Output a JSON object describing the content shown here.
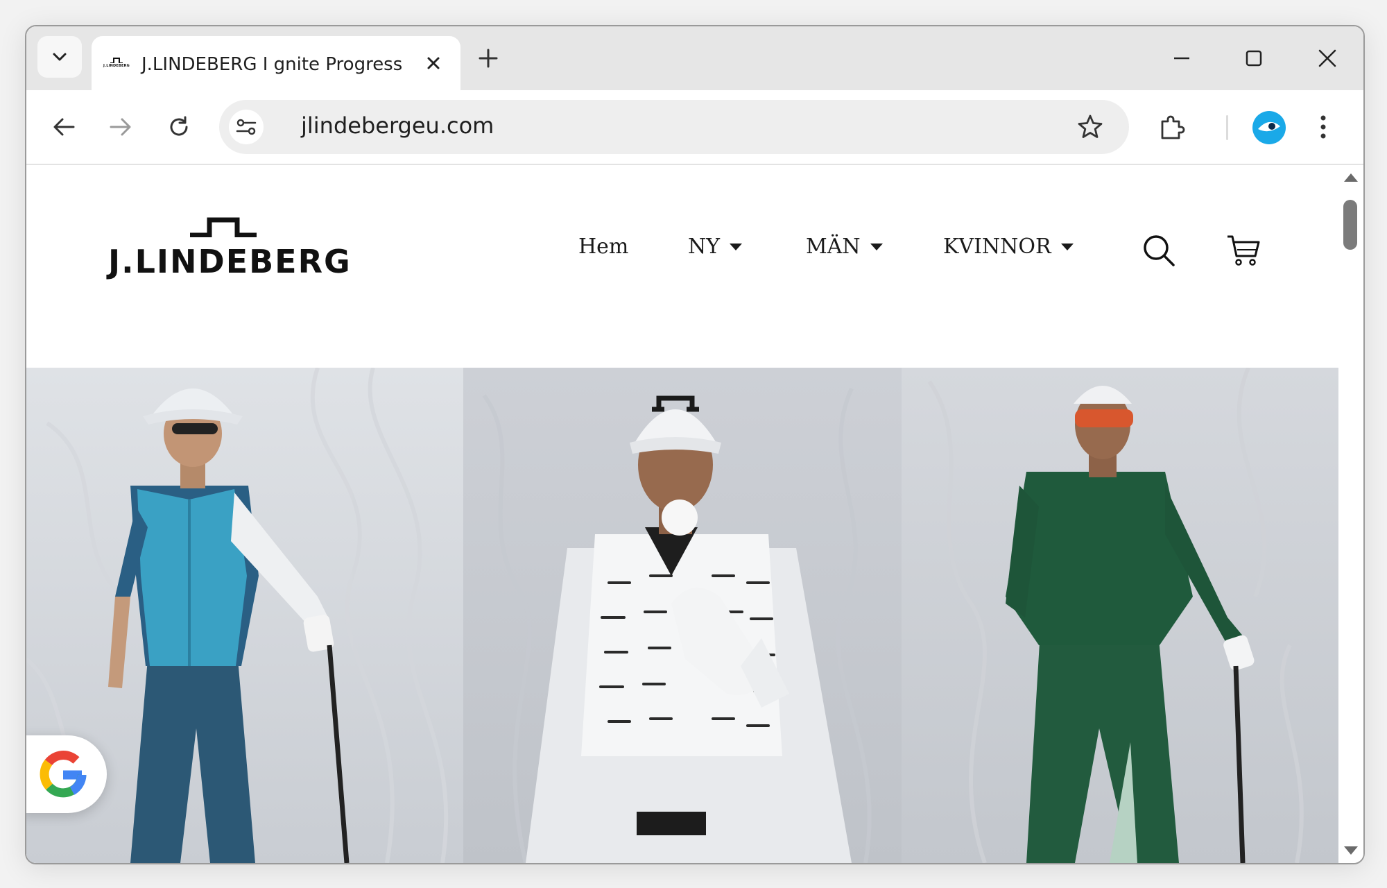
{
  "browser": {
    "tab": {
      "title": "J.LINDEBERG I gnite Progress",
      "favicon_text": "J.LINDEBERG"
    },
    "address_bar": {
      "url": "jlindebergeu.com"
    },
    "icons": {
      "tab_search": "chevron-down-icon",
      "close_tab": "close-icon",
      "new_tab": "plus-icon",
      "minimize": "minimize-icon",
      "maximize": "maximize-icon",
      "close_window": "close-icon",
      "back": "arrow-left-icon",
      "forward": "arrow-right-icon",
      "reload": "reload-icon",
      "site_info": "tune-icon",
      "bookmark": "star-icon",
      "extensions": "puzzle-icon",
      "profile": "profile-avatar-icon",
      "menu": "kebab-menu-icon"
    },
    "profile_color": "#1aa9e8"
  },
  "site": {
    "logo_text": "J.LINDEBERG",
    "nav": [
      {
        "label": "Hem",
        "has_dropdown": false
      },
      {
        "label": "NY",
        "has_dropdown": true
      },
      {
        "label": "MÄN",
        "has_dropdown": true
      },
      {
        "label": "KVINNOR",
        "has_dropdown": true
      }
    ],
    "header_icons": [
      "search-icon",
      "cart-icon"
    ],
    "hero": {
      "panels": [
        {
          "subject": "golfer in blue vest and white bucket hat"
        },
        {
          "subject": "golfer in white quilted jacket with golf ball"
        },
        {
          "subject": "golfer in green sweater and orange goggles"
        }
      ]
    },
    "floating_button": "google-icon"
  }
}
